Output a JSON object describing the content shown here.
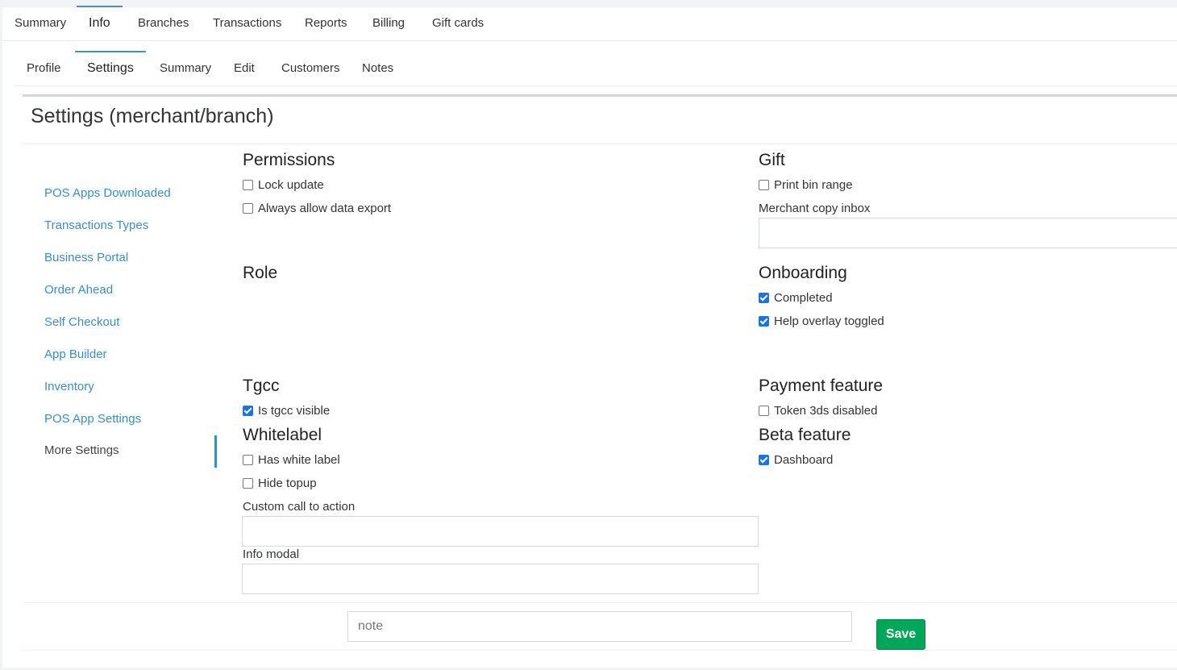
{
  "top_tabs": [
    {
      "label": "Summary"
    },
    {
      "label": "Info"
    },
    {
      "label": "Branches"
    },
    {
      "label": "Transactions"
    },
    {
      "label": "Reports"
    },
    {
      "label": "Billing"
    },
    {
      "label": "Gift cards"
    }
  ],
  "top_tabs_active": "Info",
  "sub_tabs": [
    {
      "label": "Profile"
    },
    {
      "label": "Settings"
    },
    {
      "label": "Summary"
    },
    {
      "label": "Edit"
    },
    {
      "label": "Customers"
    },
    {
      "label": "Notes"
    }
  ],
  "sub_tabs_active": "Settings",
  "panel": {
    "title": "Settings (merchant/branch)"
  },
  "sidebar": {
    "items": [
      {
        "label": "POS Apps Downloaded"
      },
      {
        "label": "Transactions Types"
      },
      {
        "label": "Business Portal"
      },
      {
        "label": "Order Ahead"
      },
      {
        "label": "Self Checkout"
      },
      {
        "label": "App Builder"
      },
      {
        "label": "Inventory"
      },
      {
        "label": "POS App Settings"
      },
      {
        "label": "More Settings"
      }
    ],
    "active": "More Settings"
  },
  "sections": {
    "permissions": {
      "title": "Permissions",
      "lock_update": {
        "label": "Lock update",
        "checked": false
      },
      "always_allow_export": {
        "label": "Always allow data export",
        "checked": false
      }
    },
    "gift": {
      "title": "Gift",
      "print_bin_range": {
        "label": "Print bin range",
        "checked": false
      },
      "merchant_copy_inbox_label": "Merchant copy inbox",
      "merchant_copy_inbox_value": ""
    },
    "role": {
      "title": "Role"
    },
    "onboarding": {
      "title": "Onboarding",
      "completed": {
        "label": "Completed",
        "checked": true
      },
      "help_overlay": {
        "label": "Help overlay toggled",
        "checked": true
      }
    },
    "tgcc": {
      "title": "Tgcc",
      "is_tgcc_visible": {
        "label": "Is tgcc visible",
        "checked": true
      }
    },
    "payment_feature": {
      "title": "Payment feature",
      "token_3ds_disabled": {
        "label": "Token 3ds disabled",
        "checked": false
      }
    },
    "whitelabel": {
      "title": "Whitelabel",
      "has_white_label": {
        "label": "Has white label",
        "checked": false
      },
      "hide_topup": {
        "label": "Hide topup",
        "checked": false
      },
      "custom_cta_label": "Custom call to action",
      "custom_cta_value": "",
      "info_modal_label": "Info modal",
      "info_modal_value": ""
    },
    "beta_feature": {
      "title": "Beta feature",
      "dashboard": {
        "label": "Dashboard",
        "checked": true
      }
    }
  },
  "footer": {
    "note_placeholder": "note",
    "save_label": "Save"
  },
  "colors": {
    "link": "#3c8dbc",
    "save": "#00a65a",
    "checkbox_checked": "#1a73e8"
  }
}
